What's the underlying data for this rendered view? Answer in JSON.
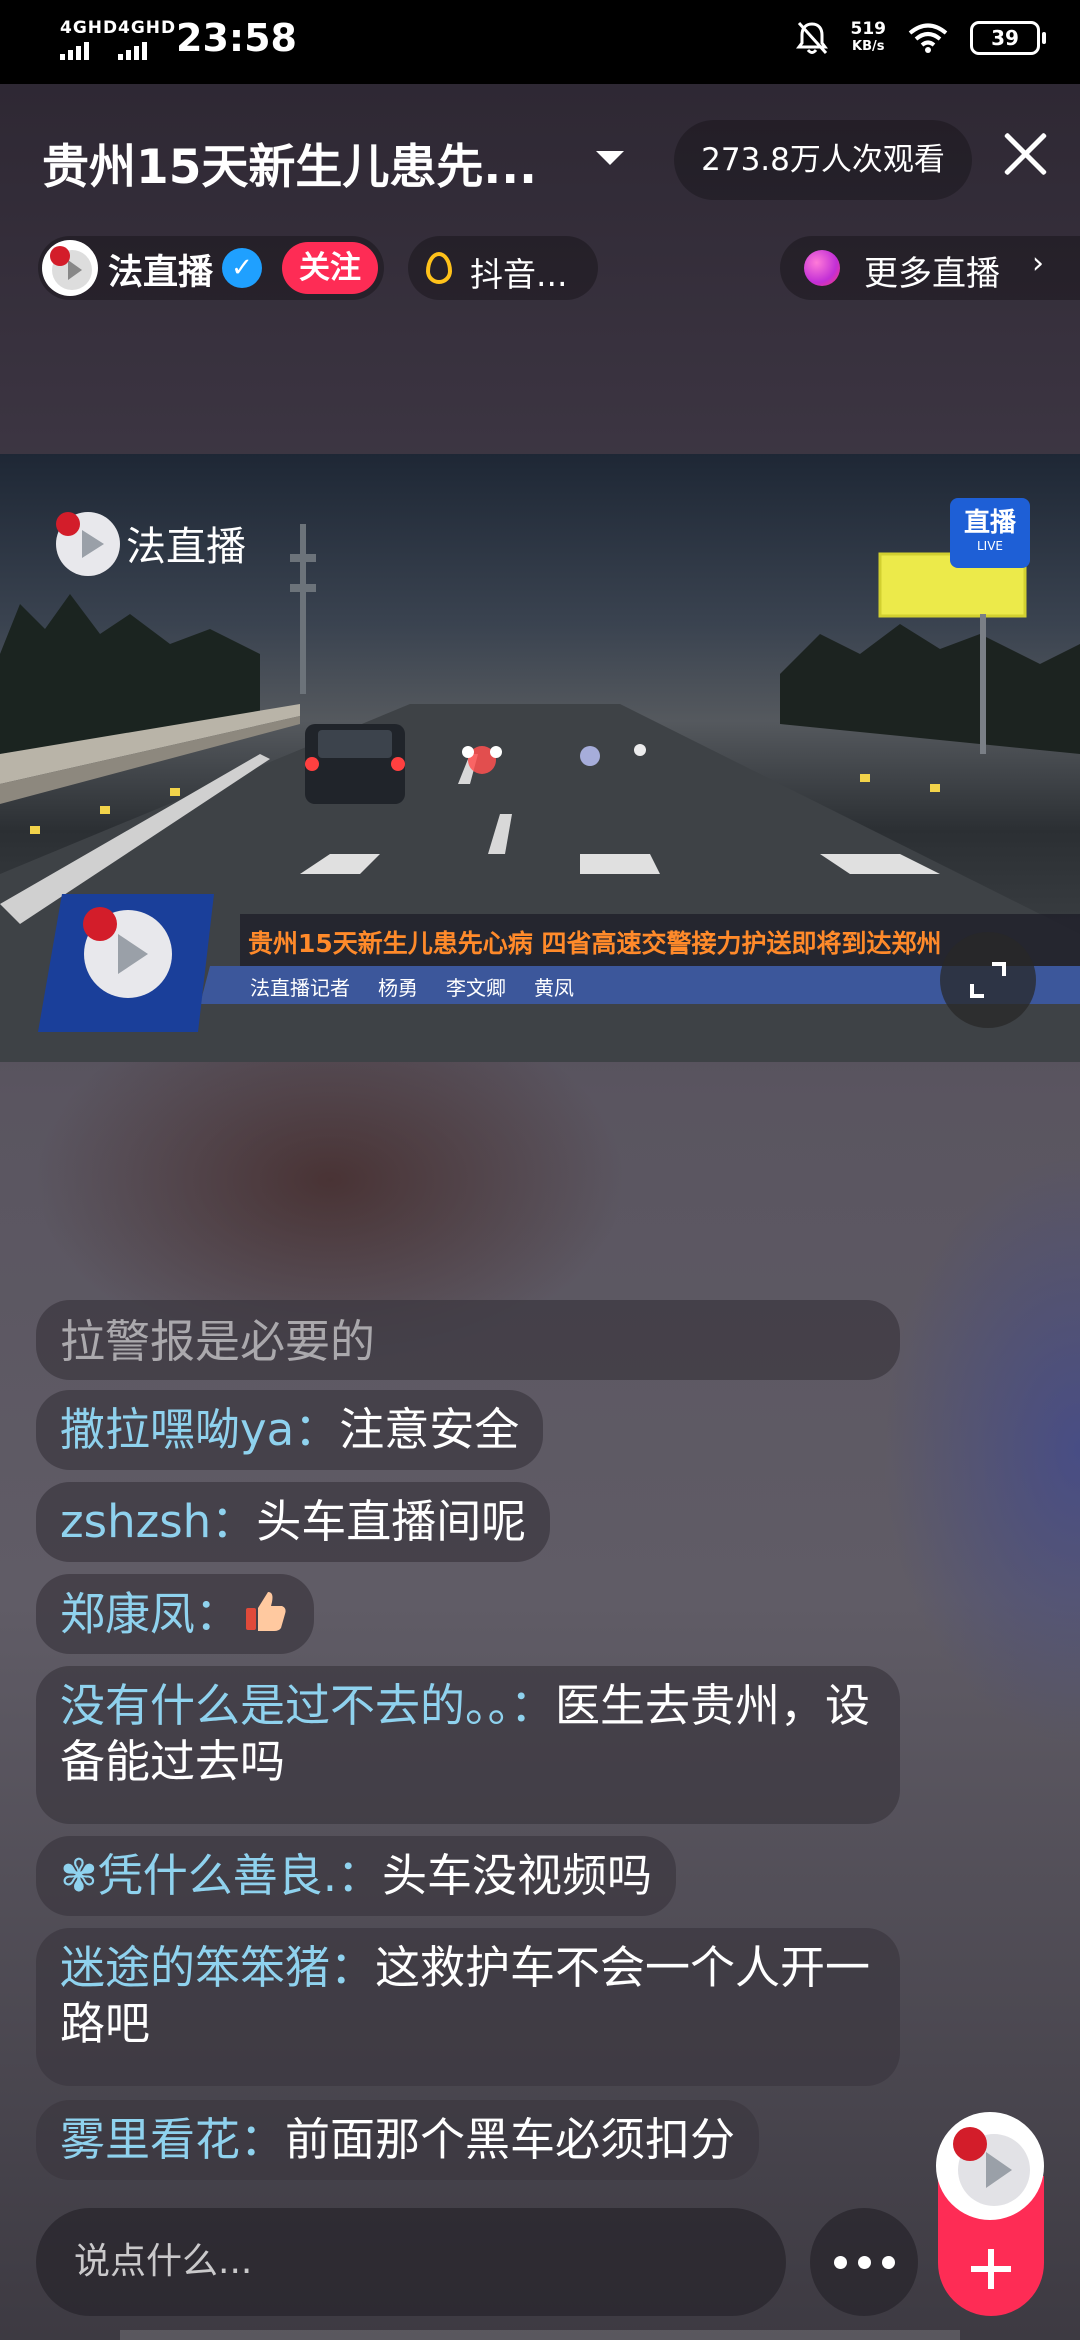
{
  "status_bar": {
    "net1": "4GHD",
    "net2": "4GHD",
    "time": "23:58",
    "speed_value": "519",
    "speed_unit": "KB/s",
    "battery": "39"
  },
  "header": {
    "title": "贵州15天新生儿患先...",
    "viewers": "273.8万人次观看",
    "anchor_name": "法直播",
    "follow_label": "关注",
    "hot_label": "抖音...",
    "more_live_label": "更多直播"
  },
  "video": {
    "logo_text": "法直播",
    "live_badge": "直播",
    "live_badge_sub": "LIVE",
    "headline": "贵州15天新生儿患先心病 四省高速交警接力护送即将到达郑州",
    "credits": [
      "法直播记者",
      "杨勇",
      "李文卿",
      "黄凤"
    ]
  },
  "chat": [
    {
      "user": "",
      "text": "拉警报是必要的"
    },
    {
      "user": "撒拉嘿呦ya：",
      "text": "注意安全"
    },
    {
      "user": "zshzsh：",
      "text": "头车直播间呢"
    },
    {
      "user": "郑康凤：",
      "text": ""
    },
    {
      "user": "没有什么是过不去的。。：",
      "text": "医生去贵州，设备能过去吗"
    },
    {
      "user": "✾凭什么善良.：",
      "text": "头车没视频吗"
    },
    {
      "user": "迷途的笨笨猪：",
      "text": "这救护车不会一个人开一路吧"
    },
    {
      "user": "雾里看花：",
      "text": "前面那个黑车必须扣分"
    }
  ],
  "input": {
    "placeholder": "说点什么..."
  },
  "colors": {
    "accent": "#fe2c55",
    "username": "#8fd2ee",
    "verified": "#1fa0ff"
  }
}
